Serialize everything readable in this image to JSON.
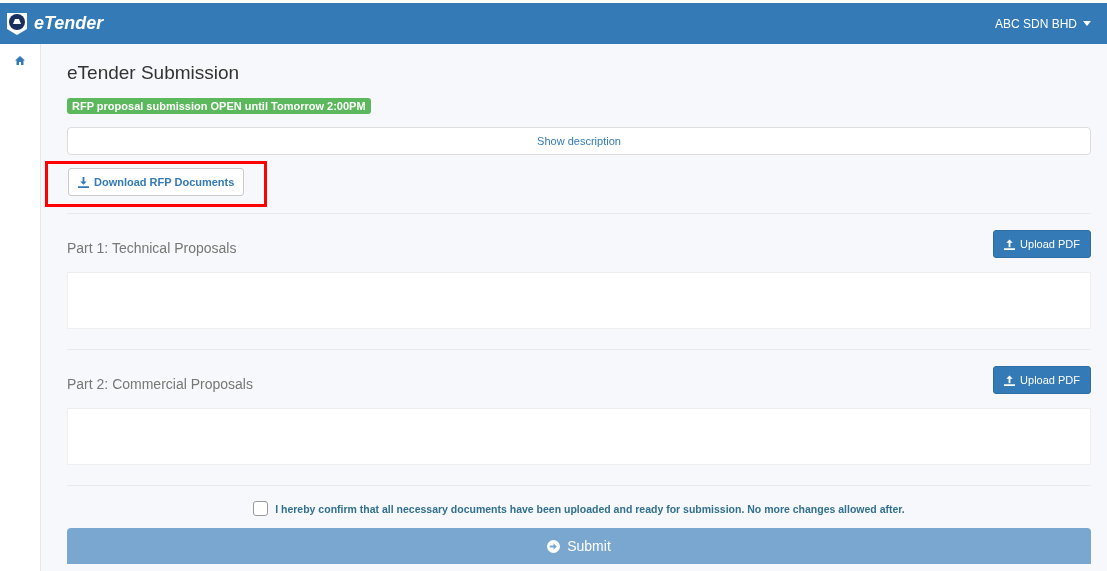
{
  "navbar": {
    "brand": "eTender",
    "account": "ABC SDN BHD"
  },
  "page": {
    "title": "eTender Submission",
    "status_badge": "RFP proposal submission OPEN until Tomorrow 2:00PM",
    "description_toggle": "Show description",
    "download_button": {
      "label": "Download RFP Documents",
      "highlighted": true
    }
  },
  "sections": [
    {
      "title": "Part 1: Technical Proposals",
      "upload_button": "Upload PDF"
    },
    {
      "title": "Part 2: Commercial Proposals",
      "upload_button": "Upload PDF"
    }
  ],
  "confirmation": {
    "label": "I hereby confirm that all necessary documents have been uploaded and ready for submission. No more changes allowed after.",
    "checked": false
  },
  "submit": {
    "label": "Submit",
    "disabled": true
  }
}
